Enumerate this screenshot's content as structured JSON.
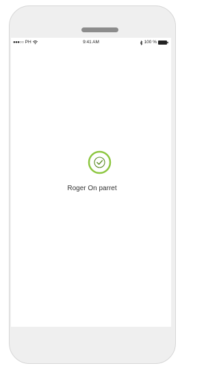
{
  "status_bar": {
    "carrier": "PH",
    "signal_dots": "●●●○○",
    "time": "9:41 AM",
    "battery_percent": "100 %"
  },
  "message": "Roger On parret",
  "colors": {
    "accent_green": "#8cc63f",
    "frame": "#efefef",
    "speaker": "#8c8c8c"
  }
}
